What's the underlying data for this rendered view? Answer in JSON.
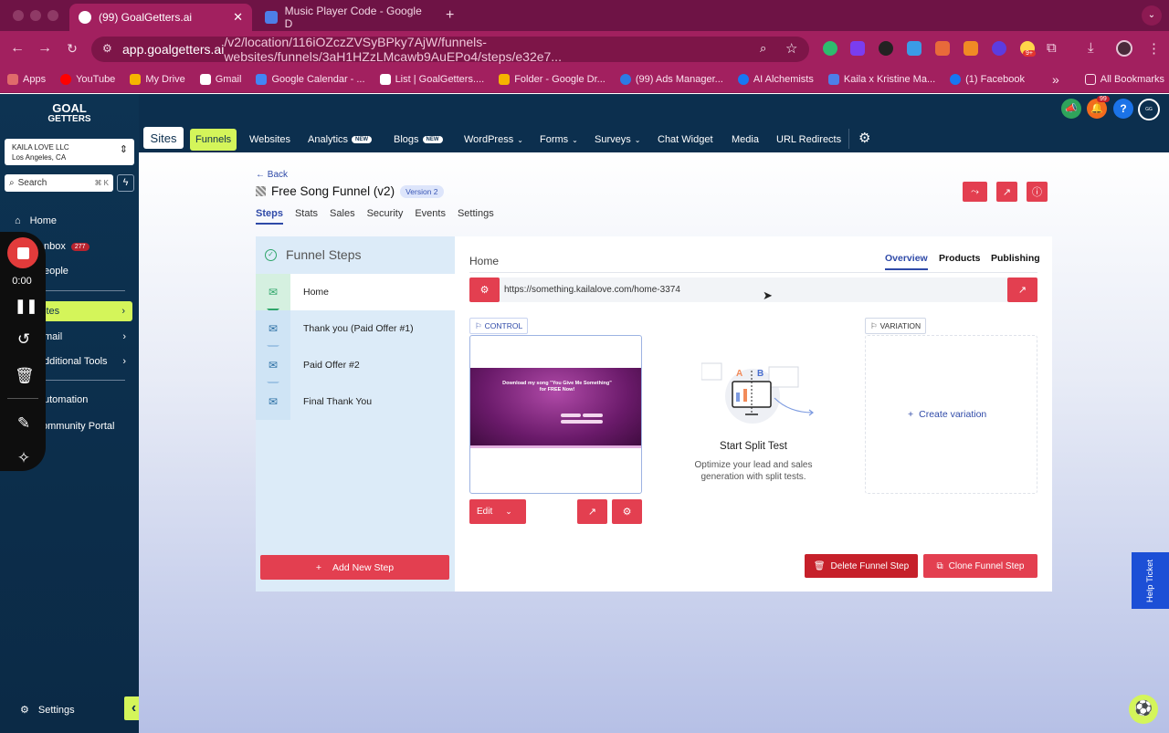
{
  "browser": {
    "tabs": [
      {
        "title": "(99) GoalGetters.ai",
        "active": true
      },
      {
        "title": "Music Player Code - Google D",
        "active": false
      }
    ],
    "new_tab_symbol": "+",
    "url_domain": "app.goalgetters.ai",
    "url_path": "/v2/location/116iOZczZVSyBPky7AjW/funnels-websites/funnels/3aH1HZzLMcawb9AuEPo4/steps/e32e7...",
    "ext_badge": "9+",
    "bookmarks": [
      "Apps",
      "YouTube",
      "My Drive",
      "Gmail",
      "Google Calendar - ...",
      "List | GoalGetters....",
      "Folder - Google Dr...",
      "(99) Ads Manager...",
      "AI Alchemists",
      "Kaila x Kristine Ma...",
      "(1) Facebook"
    ],
    "all_bookmarks": "All Bookmarks",
    "more": "»"
  },
  "app": {
    "logo_line1": "GOAL",
    "logo_line2": "GETTERS",
    "account_name": "KAILA LOVE LLC",
    "account_location": "Los Angeles, CA",
    "search_placeholder": "Search",
    "search_shortcut": "⌘ K",
    "notif_count": "99",
    "help": "?"
  },
  "sidebar": {
    "items": [
      {
        "label": "Home"
      },
      {
        "label": "nbox",
        "badge": "277"
      },
      {
        "label": "eople"
      },
      {
        "label": "ites"
      },
      {
        "label": "mail"
      },
      {
        "label": "dditional Tools"
      },
      {
        "label": "utomation"
      },
      {
        "label": "ommunity Portal"
      }
    ],
    "settings_label": "Settings",
    "collapse": "‹"
  },
  "recorder": {
    "timer": "0:00"
  },
  "topnav": {
    "sites_label": "Sites",
    "items": [
      {
        "label": "Funnels",
        "active": true
      },
      {
        "label": "Websites"
      },
      {
        "label": "Analytics",
        "badge": "NEW"
      },
      {
        "label": "Blogs",
        "badge": "NEW"
      },
      {
        "label": "WordPress",
        "dropdown": true
      },
      {
        "label": "Forms",
        "dropdown": true
      },
      {
        "label": "Surveys",
        "dropdown": true
      },
      {
        "label": "Chat Widget"
      },
      {
        "label": "Media"
      },
      {
        "label": "URL Redirects"
      }
    ]
  },
  "funnel": {
    "back_label": "← Back",
    "title": "Free Song Funnel (v2)",
    "version": "Version 2",
    "tabs": [
      "Steps",
      "Stats",
      "Sales",
      "Security",
      "Events",
      "Settings"
    ],
    "active_tab": "Steps"
  },
  "steps_panel": {
    "heading": "Funnel Steps",
    "steps": [
      "Home",
      "Thank you (Paid Offer #1)",
      "Paid Offer #2",
      "Final Thank You"
    ],
    "add_step": "Add New Step"
  },
  "detail": {
    "title": "Home",
    "tabs": [
      "Overview",
      "Products",
      "Publishing"
    ],
    "active_tab": "Overview",
    "url": "https://something.kailalove.com/home-3374",
    "control_label": "CONTROL",
    "variation_label": "VARIATION",
    "thumb_headline": "Download my song \"You Give Me Something\" for FREE Now!",
    "edit_label": "Edit",
    "split_title": "Start Split Test",
    "split_desc": "Optimize your lead and sales generation with split tests.",
    "create_variation": "Create variation",
    "delete_label": "Delete Funnel Step",
    "clone_label": "Clone Funnel Step",
    "illustration_letters": [
      "A",
      "B"
    ]
  },
  "help_ticket": "Help Ticket",
  "colors": {
    "brand_red": "#e33f50",
    "dark_red": "#c6202a",
    "nav_bg": "#0c2f4e",
    "funnels_green": "#d4f55a",
    "link_blue": "#2f4aa8"
  }
}
